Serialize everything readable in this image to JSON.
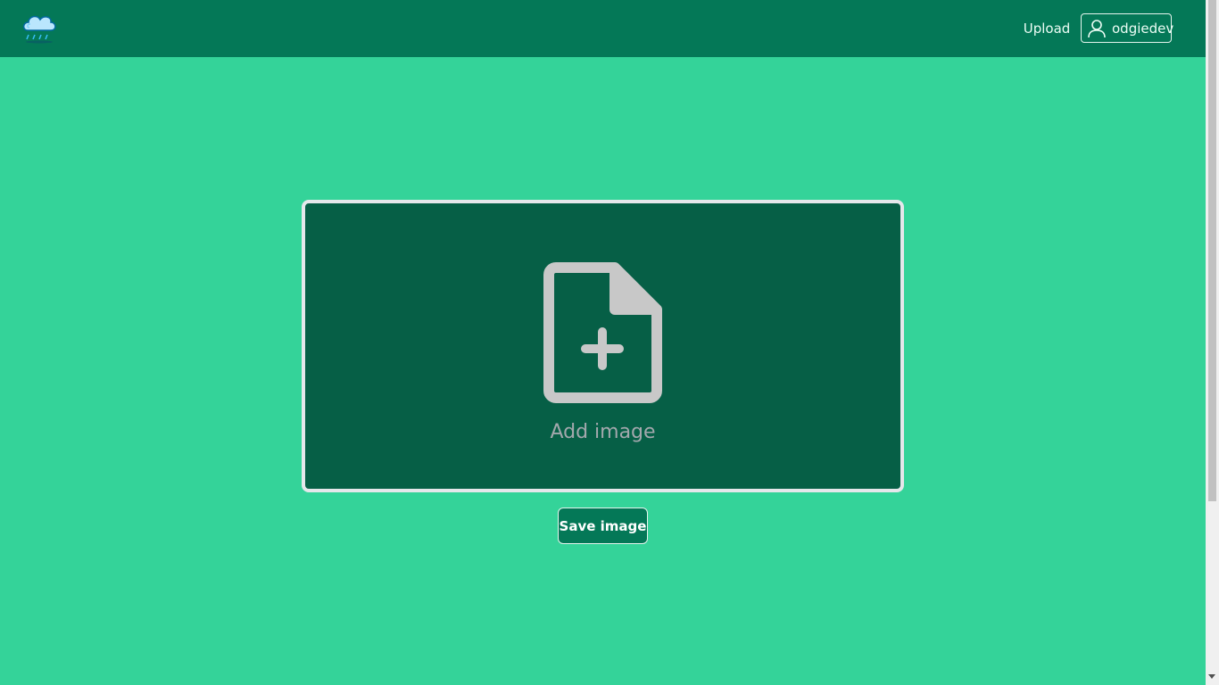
{
  "navbar": {
    "logo_icon": "cloud-rain-logo-icon",
    "upload_label": "Upload",
    "user_icon": "user-icon",
    "username": "odgiedev",
    "background": "#047857"
  },
  "main": {
    "background": "#34d399",
    "dropzone": {
      "icon": "file-plus-icon",
      "label": "Add image",
      "background": "#065f46"
    },
    "save_label": "Save image"
  }
}
